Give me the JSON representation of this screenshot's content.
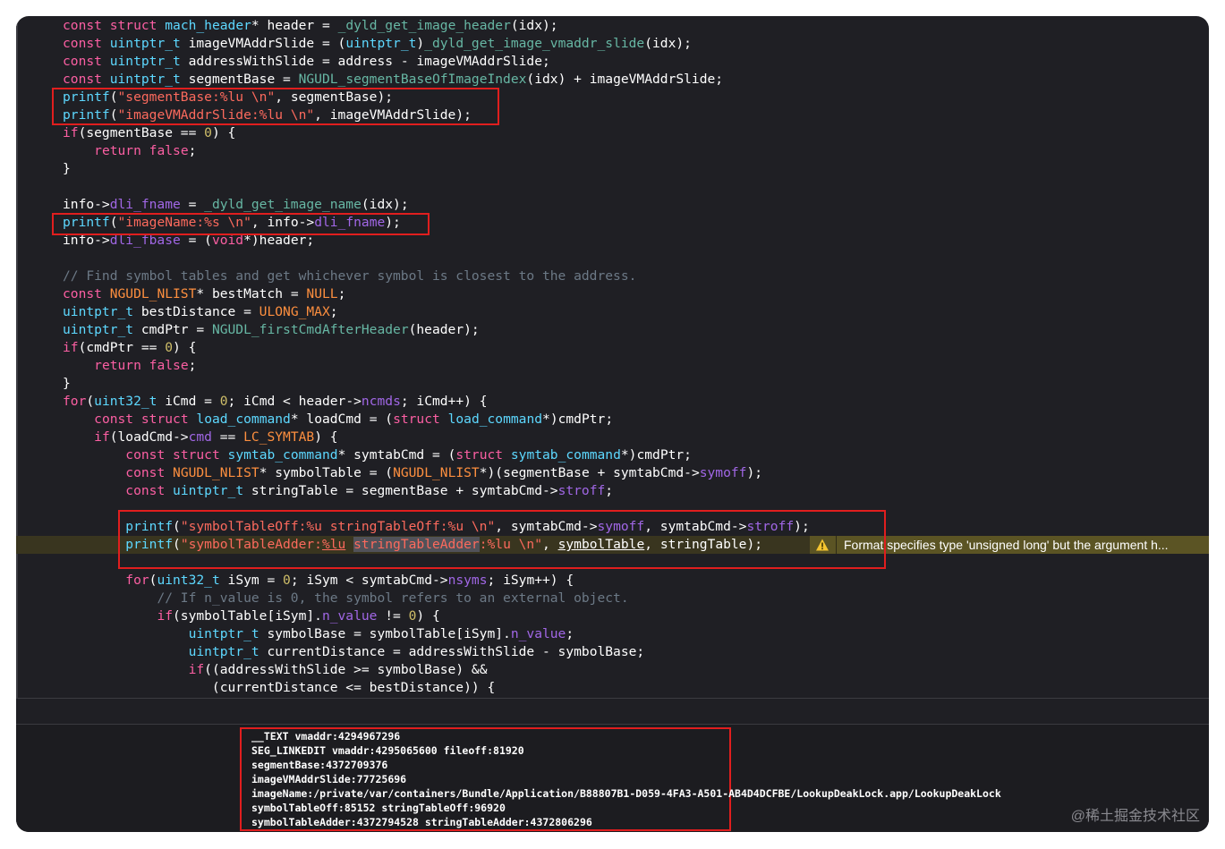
{
  "code_lines": [
    {
      "segments": [
        {
          "t": "const",
          "c": "kw"
        },
        {
          "t": " "
        },
        {
          "t": "struct",
          "c": "kw"
        },
        {
          "t": " "
        },
        {
          "t": "mach_header",
          "c": "ty"
        },
        {
          "t": "* header = "
        },
        {
          "t": "_dyld_get_image_header",
          "c": "fn"
        },
        {
          "t": "(idx);"
        }
      ]
    },
    {
      "segments": [
        {
          "t": "const",
          "c": "kw"
        },
        {
          "t": " "
        },
        {
          "t": "uintptr_t",
          "c": "ty"
        },
        {
          "t": " imageVMAddrSlide = ("
        },
        {
          "t": "uintptr_t",
          "c": "ty"
        },
        {
          "t": ")"
        },
        {
          "t": "_dyld_get_image_vmaddr_slide",
          "c": "fn"
        },
        {
          "t": "(idx);"
        }
      ]
    },
    {
      "segments": [
        {
          "t": "const",
          "c": "kw"
        },
        {
          "t": " "
        },
        {
          "t": "uintptr_t",
          "c": "ty"
        },
        {
          "t": " addressWithSlide = address - imageVMAddrSlide;"
        }
      ]
    },
    {
      "segments": [
        {
          "t": "const",
          "c": "kw"
        },
        {
          "t": " "
        },
        {
          "t": "uintptr_t",
          "c": "ty"
        },
        {
          "t": " segmentBase = "
        },
        {
          "t": "NGUDL_segmentBaseOfImageIndex",
          "c": "fn"
        },
        {
          "t": "(idx) + imageVMAddrSlide;"
        }
      ]
    },
    {
      "segments": [
        {
          "t": "printf",
          "c": "ty"
        },
        {
          "t": "("
        },
        {
          "t": "\"segmentBase:%lu \\n\"",
          "c": "str"
        },
        {
          "t": ", segmentBase);"
        }
      ]
    },
    {
      "segments": [
        {
          "t": "printf",
          "c": "ty"
        },
        {
          "t": "("
        },
        {
          "t": "\"imageVMAddrSlide:%lu \\n\"",
          "c": "str"
        },
        {
          "t": ", imageVMAddrSlide);"
        }
      ]
    },
    {
      "segments": [
        {
          "t": "if",
          "c": "kw"
        },
        {
          "t": "(segmentBase == "
        },
        {
          "t": "0",
          "c": "num"
        },
        {
          "t": ") {"
        }
      ]
    },
    {
      "segments": [
        {
          "t": "    "
        },
        {
          "t": "return",
          "c": "kw"
        },
        {
          "t": " "
        },
        {
          "t": "false",
          "c": "kw"
        },
        {
          "t": ";"
        }
      ]
    },
    {
      "segments": [
        {
          "t": "}"
        }
      ]
    },
    {
      "segments": []
    },
    {
      "segments": [
        {
          "t": "info->"
        },
        {
          "t": "dli_fname",
          "c": "mb"
        },
        {
          "t": " = "
        },
        {
          "t": "_dyld_get_image_name",
          "c": "fn"
        },
        {
          "t": "(idx);"
        }
      ]
    },
    {
      "segments": [
        {
          "t": "printf",
          "c": "ty"
        },
        {
          "t": "("
        },
        {
          "t": "\"imageName:%s \\n\"",
          "c": "str"
        },
        {
          "t": ", info->"
        },
        {
          "t": "dli_fname",
          "c": "mb"
        },
        {
          "t": ");"
        }
      ]
    },
    {
      "segments": [
        {
          "t": "info->"
        },
        {
          "t": "dli_fbase",
          "c": "mb"
        },
        {
          "t": " = ("
        },
        {
          "t": "void",
          "c": "kw"
        },
        {
          "t": "*)header;"
        }
      ]
    },
    {
      "segments": []
    },
    {
      "segments": [
        {
          "t": "// Find symbol tables and get whichever symbol is closest to the address.",
          "c": "cmt"
        }
      ]
    },
    {
      "segments": [
        {
          "t": "const",
          "c": "kw"
        },
        {
          "t": " "
        },
        {
          "t": "NGUDL_NLIST",
          "c": "mac"
        },
        {
          "t": "* bestMatch = "
        },
        {
          "t": "NULL",
          "c": "mac"
        },
        {
          "t": ";"
        }
      ]
    },
    {
      "segments": [
        {
          "t": "uintptr_t",
          "c": "ty"
        },
        {
          "t": " bestDistance = "
        },
        {
          "t": "ULONG_MAX",
          "c": "mac"
        },
        {
          "t": ";"
        }
      ]
    },
    {
      "segments": [
        {
          "t": "uintptr_t",
          "c": "ty"
        },
        {
          "t": " cmdPtr = "
        },
        {
          "t": "NGUDL_firstCmdAfterHeader",
          "c": "fn"
        },
        {
          "t": "(header);"
        }
      ]
    },
    {
      "segments": [
        {
          "t": "if",
          "c": "kw"
        },
        {
          "t": "(cmdPtr == "
        },
        {
          "t": "0",
          "c": "num"
        },
        {
          "t": ") {"
        }
      ]
    },
    {
      "segments": [
        {
          "t": "    "
        },
        {
          "t": "return",
          "c": "kw"
        },
        {
          "t": " "
        },
        {
          "t": "false",
          "c": "kw"
        },
        {
          "t": ";"
        }
      ]
    },
    {
      "segments": [
        {
          "t": "}"
        }
      ]
    },
    {
      "segments": [
        {
          "t": "for",
          "c": "kw"
        },
        {
          "t": "("
        },
        {
          "t": "uint32_t",
          "c": "ty"
        },
        {
          "t": " iCmd = "
        },
        {
          "t": "0",
          "c": "num"
        },
        {
          "t": "; iCmd < header->"
        },
        {
          "t": "ncmds",
          "c": "mb"
        },
        {
          "t": "; iCmd++) {"
        }
      ]
    },
    {
      "segments": [
        {
          "t": "    "
        },
        {
          "t": "const",
          "c": "kw"
        },
        {
          "t": " "
        },
        {
          "t": "struct",
          "c": "kw"
        },
        {
          "t": " "
        },
        {
          "t": "load_command",
          "c": "ty"
        },
        {
          "t": "* loadCmd = ("
        },
        {
          "t": "struct",
          "c": "kw"
        },
        {
          "t": " "
        },
        {
          "t": "load_command",
          "c": "ty"
        },
        {
          "t": "*)cmdPtr;"
        }
      ]
    },
    {
      "segments": [
        {
          "t": "    "
        },
        {
          "t": "if",
          "c": "kw"
        },
        {
          "t": "(loadCmd->"
        },
        {
          "t": "cmd",
          "c": "mb"
        },
        {
          "t": " == "
        },
        {
          "t": "LC_SYMTAB",
          "c": "mac"
        },
        {
          "t": ") {"
        }
      ]
    },
    {
      "segments": [
        {
          "t": "        "
        },
        {
          "t": "const",
          "c": "kw"
        },
        {
          "t": " "
        },
        {
          "t": "struct",
          "c": "kw"
        },
        {
          "t": " "
        },
        {
          "t": "symtab_command",
          "c": "ty"
        },
        {
          "t": "* symtabCmd = ("
        },
        {
          "t": "struct",
          "c": "kw"
        },
        {
          "t": " "
        },
        {
          "t": "symtab_command",
          "c": "ty"
        },
        {
          "t": "*)cmdPtr;"
        }
      ]
    },
    {
      "segments": [
        {
          "t": "        "
        },
        {
          "t": "const",
          "c": "kw"
        },
        {
          "t": " "
        },
        {
          "t": "NGUDL_NLIST",
          "c": "mac"
        },
        {
          "t": "* symbolTable = ("
        },
        {
          "t": "NGUDL_NLIST",
          "c": "mac"
        },
        {
          "t": "*)(segmentBase + symtabCmd->"
        },
        {
          "t": "symoff",
          "c": "mb"
        },
        {
          "t": ");"
        }
      ]
    },
    {
      "segments": [
        {
          "t": "        "
        },
        {
          "t": "const",
          "c": "kw"
        },
        {
          "t": " "
        },
        {
          "t": "uintptr_t",
          "c": "ty"
        },
        {
          "t": " stringTable = segmentBase + symtabCmd->"
        },
        {
          "t": "stroff",
          "c": "mb"
        },
        {
          "t": ";"
        }
      ]
    },
    {
      "segments": []
    },
    {
      "segments": [
        {
          "t": "        "
        },
        {
          "t": "printf",
          "c": "ty"
        },
        {
          "t": "("
        },
        {
          "t": "\"symbolTableOff:%u stringTableOff:%u \\n\"",
          "c": "str"
        },
        {
          "t": ", symtabCmd->"
        },
        {
          "t": "symoff",
          "c": "mb"
        },
        {
          "t": ", symtabCmd->"
        },
        {
          "t": "stroff",
          "c": "mb"
        },
        {
          "t": ");"
        }
      ]
    },
    {
      "segments": [
        {
          "t": "        "
        },
        {
          "t": "printf",
          "c": "ty"
        },
        {
          "t": "("
        },
        {
          "t": "\"symbolTableAdder:",
          "c": "str"
        },
        {
          "t": "%lu",
          "c": "str ul"
        },
        {
          "t": " ",
          "c": "str"
        },
        {
          "t": "stringTableAdder",
          "c": "str sel"
        },
        {
          "t": ":%lu \\n\"",
          "c": "str"
        },
        {
          "t": ", "
        },
        {
          "t": "symbolTable",
          "c": "ul"
        },
        {
          "t": ", stringTable);"
        }
      ],
      "warning": true
    },
    {
      "segments": []
    },
    {
      "segments": [
        {
          "t": "        "
        },
        {
          "t": "for",
          "c": "kw"
        },
        {
          "t": "("
        },
        {
          "t": "uint32_t",
          "c": "ty"
        },
        {
          "t": " iSym = "
        },
        {
          "t": "0",
          "c": "num"
        },
        {
          "t": "; iSym < symtabCmd->"
        },
        {
          "t": "nsyms",
          "c": "mb"
        },
        {
          "t": "; iSym++) {"
        }
      ]
    },
    {
      "segments": [
        {
          "t": "            "
        },
        {
          "t": "// If n_value is 0, the symbol refers to an external object.",
          "c": "cmt"
        }
      ]
    },
    {
      "segments": [
        {
          "t": "            "
        },
        {
          "t": "if",
          "c": "kw"
        },
        {
          "t": "(symbolTable[iSym]."
        },
        {
          "t": "n_value",
          "c": "mb"
        },
        {
          "t": " != "
        },
        {
          "t": "0",
          "c": "num"
        },
        {
          "t": ") {"
        }
      ]
    },
    {
      "segments": [
        {
          "t": "                "
        },
        {
          "t": "uintptr_t",
          "c": "ty"
        },
        {
          "t": " symbolBase = symbolTable[iSym]."
        },
        {
          "t": "n_value",
          "c": "mb"
        },
        {
          "t": ";"
        }
      ]
    },
    {
      "segments": [
        {
          "t": "                "
        },
        {
          "t": "uintptr_t",
          "c": "ty"
        },
        {
          "t": " currentDistance = addressWithSlide - symbolBase;"
        }
      ]
    },
    {
      "segments": [
        {
          "t": "                "
        },
        {
          "t": "if",
          "c": "kw"
        },
        {
          "t": "((addressWithSlide >= symbolBase) &&"
        }
      ]
    },
    {
      "segments": [
        {
          "t": "                   (currentDistance <= bestDistance)) {"
        }
      ]
    }
  ],
  "warning": {
    "text": "Format specifies type 'unsigned long' but the argument h..."
  },
  "console_lines": [
    "__TEXT vmaddr:4294967296",
    "SEG_LINKEDIT vmaddr:4295065600 fileoff:81920",
    "segmentBase:4372709376",
    "imageVMAddrSlide:77725696",
    "imageName:/private/var/containers/Bundle/Application/B88807B1-D059-4FA3-A501-AB4D4DCFBE/LookupDeakLock.app/LookupDeakLock",
    "symbolTableOff:85152 stringTableOff:96920",
    "symbolTableAdder:4372794528 stringTableAdder:4372806296"
  ],
  "watermark": "@稀土掘金技术社区",
  "colors": {
    "editor_bg": "#1f1f24",
    "keyword": "#fc5fa3",
    "type": "#5dd8ff",
    "function": "#67b7a4",
    "member": "#a167e6",
    "string": "#fc6a5d",
    "number": "#d0bf69",
    "comment": "#6c7986",
    "macro": "#fd8f3f",
    "highlight_box": "#e01e1e",
    "warning_bg": "#5b5424"
  }
}
